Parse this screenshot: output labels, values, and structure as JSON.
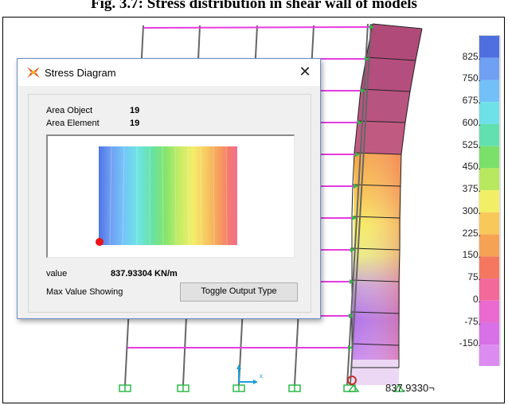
{
  "caption": "Fig. 3.7: Stress distribution in shear wall of models",
  "result_value_tag": "837.9330",
  "color_scale": {
    "labels": [
      "825.",
      "750.",
      "675.",
      "600.",
      "525.",
      "450.",
      "375.",
      "300.",
      "225.",
      "150.",
      "75.",
      "0.",
      "-75.",
      "-150."
    ],
    "colors": [
      "#4f6fe0",
      "#6fa0f2",
      "#73c0f8",
      "#6ee0e8",
      "#62e0b0",
      "#7ae06a",
      "#b8e860",
      "#f2ef66",
      "#f8c85a",
      "#f6a254",
      "#f47860",
      "#f26a9a",
      "#e96ad0",
      "#d870e8",
      "#dc8cf0"
    ]
  },
  "dialog": {
    "title": "Stress Diagram",
    "close_symbol": "✕",
    "area_object_label": "Area Object",
    "area_object_value": "19",
    "area_element_label": "Area Element",
    "area_element_value": "19",
    "value_label": "value",
    "value_reading": "837.93304  KN/m",
    "status_text": "Max Value Showing",
    "toggle_button_label": "Toggle Output Type"
  },
  "axis_label_x": "x"
}
